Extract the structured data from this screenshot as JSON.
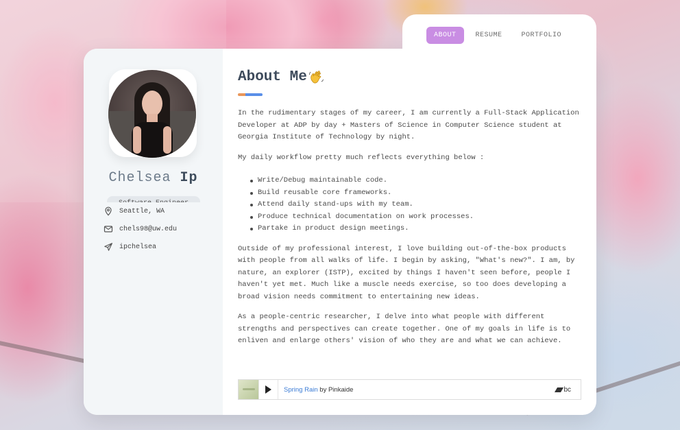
{
  "nav": {
    "items": [
      {
        "label": "ABOUT",
        "active": true
      },
      {
        "label": "RESUME",
        "active": false
      },
      {
        "label": "PORTFOLIO",
        "active": false
      }
    ]
  },
  "profile": {
    "first_name": "Chelsea",
    "last_name": "Ip",
    "title_partial": "Software Engineer",
    "location": "Seattle, WA",
    "email": "chels98@uw.edu",
    "handle": "ipchelsea"
  },
  "about": {
    "heading": "About Me",
    "intro": "In the rudimentary stages of my career, I am currently a Full-Stack Application Developer at ADP by day + Masters of Science in Computer Science student at Georgia Institute of Technology by night.",
    "workflow_intro": "My daily workflow pretty much reflects everything below :",
    "workflow_items": [
      "Write/Debug maintainable code.",
      "Build reusable core frameworks.",
      "Attend daily stand-ups with my team.",
      "Produce technical documentation on work processes.",
      "Partake in product design meetings."
    ],
    "interests": "Outside of my professional interest, I love building out-of-the-box products with people from all walks of life. I begin by asking, \"What's new?\". I am, by nature, an explorer (ISTP), excited by things I haven't seen before, people I haven't yet met. Much like a muscle needs exercise, so too does developing a broad vision needs commitment to entertaining new ideas.",
    "research": "As a people-centric researcher, I delve into what people with different strengths and perspectives can create together. One of my goals in life is to enliven and enlarge others' vision of who they are and what we can achieve."
  },
  "player": {
    "track_title": "Spring Rain",
    "by_label": "by",
    "artist": "Pinkaide",
    "brand": "bc"
  },
  "colors": {
    "accent_purple": "#c98de3",
    "heading": "#3e4b5c",
    "link": "#3a7bd5"
  }
}
